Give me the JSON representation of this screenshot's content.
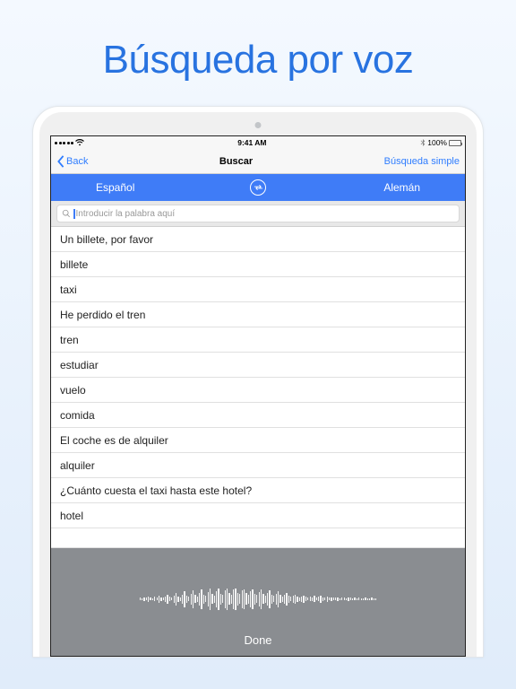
{
  "hero_title": "Búsqueda por voz",
  "status": {
    "carrier_wifi": "",
    "time": "9:41 AM",
    "battery_pct": "100%"
  },
  "nav": {
    "back_label": "Back",
    "title": "Buscar",
    "right_label": "Búsqueda simple"
  },
  "langs": {
    "left": "Español",
    "right": "Alemán"
  },
  "search": {
    "placeholder": "Introducir la palabra aquí"
  },
  "rows": [
    "Un billete, por favor",
    "billete",
    "taxi",
    "He perdido el tren",
    "tren",
    "estudiar",
    "vuelo",
    "comida",
    "El coche es de alquiler",
    "alquiler",
    "¿Cuánto cuesta el taxi hasta este hotel?",
    "hotel"
  ],
  "voice": {
    "done_label": "Done"
  }
}
